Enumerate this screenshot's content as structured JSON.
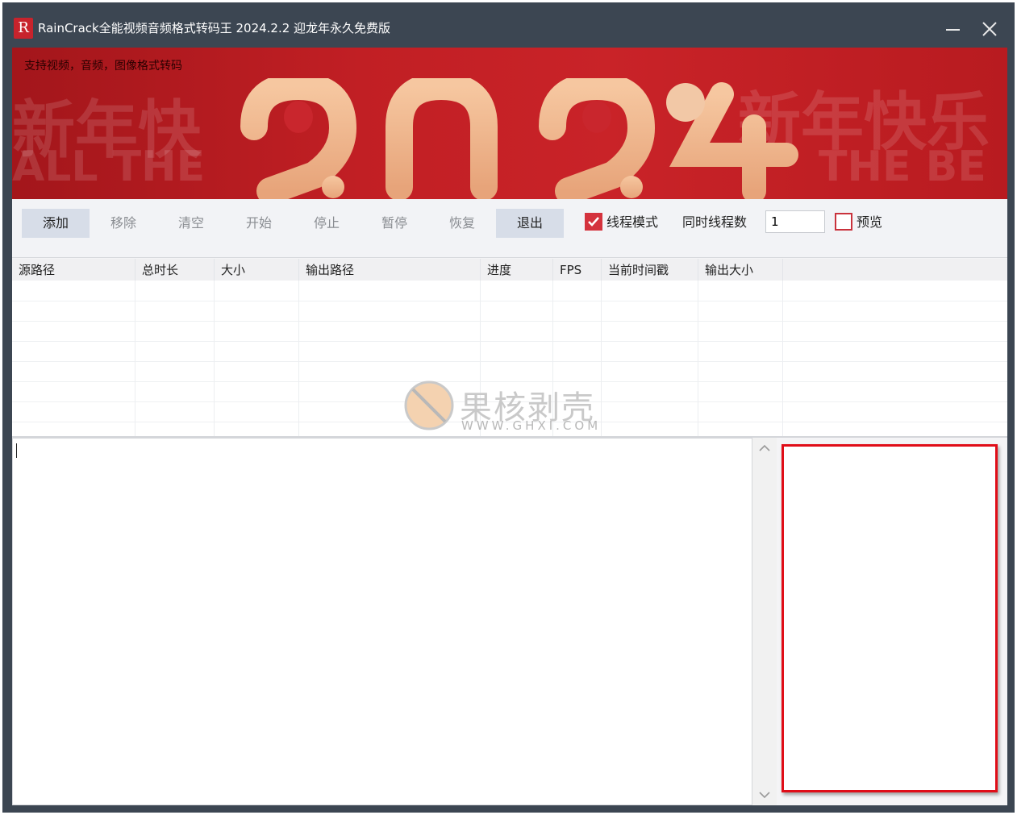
{
  "window": {
    "app_logo": "R",
    "title": "RainCrack全能视频音频格式转码王 2024.2.2 迎龙年永久免费版",
    "minimize_icon": "minimize-icon",
    "close_icon": "close-icon"
  },
  "banner": {
    "notice": "支持视频，音频，图像格式转码",
    "year_text": "2024"
  },
  "toolbar": {
    "buttons": [
      {
        "label": "添加"
      },
      {
        "label": "移除"
      },
      {
        "label": "清空"
      },
      {
        "label": "开始"
      },
      {
        "label": "停止"
      },
      {
        "label": "暂停"
      },
      {
        "label": "恢复"
      },
      {
        "label": "退出"
      }
    ],
    "thread_mode": {
      "label": "线程模式",
      "checked": true
    },
    "concurrent_threads": {
      "label": "同时线程数",
      "value": "1"
    },
    "preview": {
      "label": "预览",
      "checked": false
    }
  },
  "table": {
    "columns": [
      "源路径",
      "总时长",
      "大小",
      "输出路径",
      "进度",
      "FPS",
      "当前时间戳",
      "输出大小"
    ],
    "rows": []
  },
  "watermark": {
    "name": "果核剥壳",
    "url": "WWW.GHXI.COM"
  },
  "colors": {
    "titlebar": "#3c4652",
    "accent": "#d4323d",
    "preview_border": "#e00d18"
  }
}
